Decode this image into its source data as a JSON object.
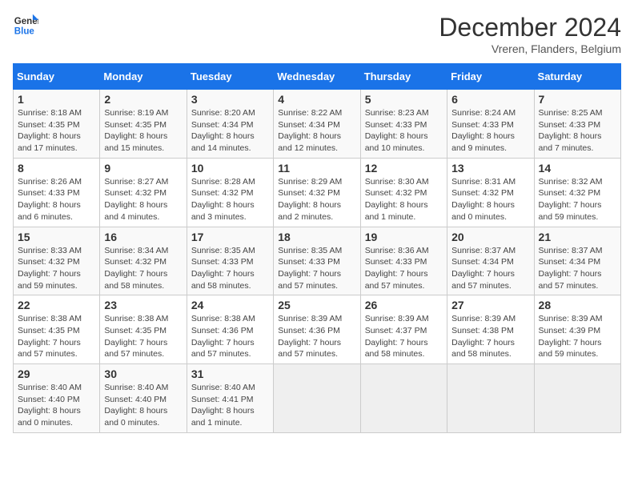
{
  "logo": {
    "line1": "General",
    "line2": "Blue"
  },
  "title": "December 2024",
  "location": "Vreren, Flanders, Belgium",
  "days_of_week": [
    "Sunday",
    "Monday",
    "Tuesday",
    "Wednesday",
    "Thursday",
    "Friday",
    "Saturday"
  ],
  "weeks": [
    [
      {
        "day": "1",
        "sunrise": "8:18 AM",
        "sunset": "4:35 PM",
        "daylight": "8 hours and 17 minutes."
      },
      {
        "day": "2",
        "sunrise": "8:19 AM",
        "sunset": "4:35 PM",
        "daylight": "8 hours and 15 minutes."
      },
      {
        "day": "3",
        "sunrise": "8:20 AM",
        "sunset": "4:34 PM",
        "daylight": "8 hours and 14 minutes."
      },
      {
        "day": "4",
        "sunrise": "8:22 AM",
        "sunset": "4:34 PM",
        "daylight": "8 hours and 12 minutes."
      },
      {
        "day": "5",
        "sunrise": "8:23 AM",
        "sunset": "4:33 PM",
        "daylight": "8 hours and 10 minutes."
      },
      {
        "day": "6",
        "sunrise": "8:24 AM",
        "sunset": "4:33 PM",
        "daylight": "8 hours and 9 minutes."
      },
      {
        "day": "7",
        "sunrise": "8:25 AM",
        "sunset": "4:33 PM",
        "daylight": "8 hours and 7 minutes."
      }
    ],
    [
      {
        "day": "8",
        "sunrise": "8:26 AM",
        "sunset": "4:33 PM",
        "daylight": "8 hours and 6 minutes."
      },
      {
        "day": "9",
        "sunrise": "8:27 AM",
        "sunset": "4:32 PM",
        "daylight": "8 hours and 4 minutes."
      },
      {
        "day": "10",
        "sunrise": "8:28 AM",
        "sunset": "4:32 PM",
        "daylight": "8 hours and 3 minutes."
      },
      {
        "day": "11",
        "sunrise": "8:29 AM",
        "sunset": "4:32 PM",
        "daylight": "8 hours and 2 minutes."
      },
      {
        "day": "12",
        "sunrise": "8:30 AM",
        "sunset": "4:32 PM",
        "daylight": "8 hours and 1 minute."
      },
      {
        "day": "13",
        "sunrise": "8:31 AM",
        "sunset": "4:32 PM",
        "daylight": "8 hours and 0 minutes."
      },
      {
        "day": "14",
        "sunrise": "8:32 AM",
        "sunset": "4:32 PM",
        "daylight": "7 hours and 59 minutes."
      }
    ],
    [
      {
        "day": "15",
        "sunrise": "8:33 AM",
        "sunset": "4:32 PM",
        "daylight": "7 hours and 59 minutes."
      },
      {
        "day": "16",
        "sunrise": "8:34 AM",
        "sunset": "4:32 PM",
        "daylight": "7 hours and 58 minutes."
      },
      {
        "day": "17",
        "sunrise": "8:35 AM",
        "sunset": "4:33 PM",
        "daylight": "7 hours and 58 minutes."
      },
      {
        "day": "18",
        "sunrise": "8:35 AM",
        "sunset": "4:33 PM",
        "daylight": "7 hours and 57 minutes."
      },
      {
        "day": "19",
        "sunrise": "8:36 AM",
        "sunset": "4:33 PM",
        "daylight": "7 hours and 57 minutes."
      },
      {
        "day": "20",
        "sunrise": "8:37 AM",
        "sunset": "4:34 PM",
        "daylight": "7 hours and 57 minutes."
      },
      {
        "day": "21",
        "sunrise": "8:37 AM",
        "sunset": "4:34 PM",
        "daylight": "7 hours and 57 minutes."
      }
    ],
    [
      {
        "day": "22",
        "sunrise": "8:38 AM",
        "sunset": "4:35 PM",
        "daylight": "7 hours and 57 minutes."
      },
      {
        "day": "23",
        "sunrise": "8:38 AM",
        "sunset": "4:35 PM",
        "daylight": "7 hours and 57 minutes."
      },
      {
        "day": "24",
        "sunrise": "8:38 AM",
        "sunset": "4:36 PM",
        "daylight": "7 hours and 57 minutes."
      },
      {
        "day": "25",
        "sunrise": "8:39 AM",
        "sunset": "4:36 PM",
        "daylight": "7 hours and 57 minutes."
      },
      {
        "day": "26",
        "sunrise": "8:39 AM",
        "sunset": "4:37 PM",
        "daylight": "7 hours and 58 minutes."
      },
      {
        "day": "27",
        "sunrise": "8:39 AM",
        "sunset": "4:38 PM",
        "daylight": "7 hours and 58 minutes."
      },
      {
        "day": "28",
        "sunrise": "8:39 AM",
        "sunset": "4:39 PM",
        "daylight": "7 hours and 59 minutes."
      }
    ],
    [
      {
        "day": "29",
        "sunrise": "8:40 AM",
        "sunset": "4:40 PM",
        "daylight": "8 hours and 0 minutes."
      },
      {
        "day": "30",
        "sunrise": "8:40 AM",
        "sunset": "4:40 PM",
        "daylight": "8 hours and 0 minutes."
      },
      {
        "day": "31",
        "sunrise": "8:40 AM",
        "sunset": "4:41 PM",
        "daylight": "8 hours and 1 minute."
      },
      null,
      null,
      null,
      null
    ]
  ],
  "labels": {
    "sunrise": "Sunrise:",
    "sunset": "Sunset:",
    "daylight": "Daylight:"
  }
}
